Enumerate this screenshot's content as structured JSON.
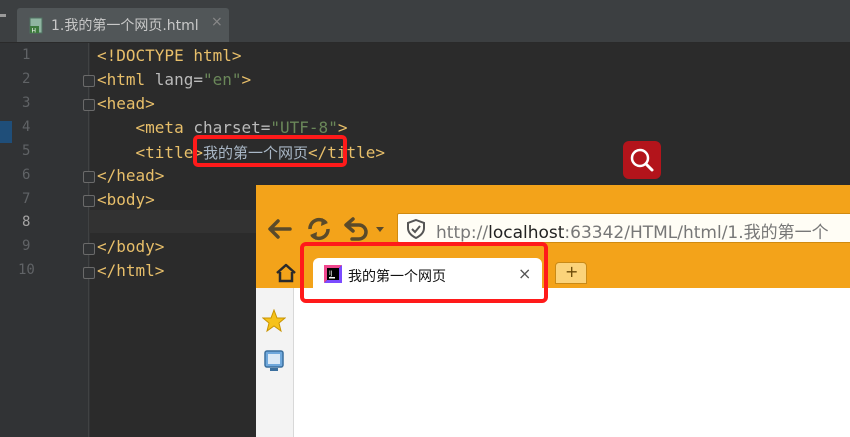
{
  "ide": {
    "tab": {
      "label": "1.我的第一个网页.html",
      "close": "×",
      "icon": "html-file-icon"
    },
    "line_numbers": [
      "1",
      "2",
      "3",
      "4",
      "5",
      "6",
      "7",
      "8",
      "9",
      "10"
    ],
    "code": {
      "l1": "<!DOCTYPE html>",
      "l2_open": "<html ",
      "l2_attr": "lang=",
      "l2_val": "\"en\"",
      "l2_close": ">",
      "l3": "<head>",
      "l4_open": "    <meta ",
      "l4_attr": "charset=",
      "l4_val": "\"UTF-8\"",
      "l4_close": ">",
      "l5_open": "    <title>",
      "l5_text": "我的第一个网页",
      "l5_close": "</title>",
      "l6": "</head>",
      "l7": "<body>",
      "l9": "</body>",
      "l10": "</html>"
    },
    "colors": {
      "tag": "#e8bf6a",
      "attr": "#bababa",
      "string": "#6a8759",
      "text": "#a9b7c6",
      "highlight": "#ff1a1a"
    }
  },
  "search_badge": {
    "icon": "magnifier-icon",
    "color": "#b3141b"
  },
  "browser": {
    "toolbar": {
      "back_icon": "back-arrow-icon",
      "reload_icon": "reload-icon",
      "undo_icon": "undo-icon",
      "shield_icon": "shield-icon"
    },
    "url": {
      "prefix": "http://",
      "host": "localhost",
      "rest": ":63342/HTML/html/1.我的第一个"
    },
    "home_icon": "home-icon",
    "tab": {
      "label": "我的第一个网页",
      "close": "×",
      "favicon": "jetbrains-icon"
    },
    "new_tab": "+",
    "sidebar": {
      "favorites_icon": "star-icon",
      "monitor_icon": "monitor-icon"
    },
    "accent": "#f3a31a"
  }
}
